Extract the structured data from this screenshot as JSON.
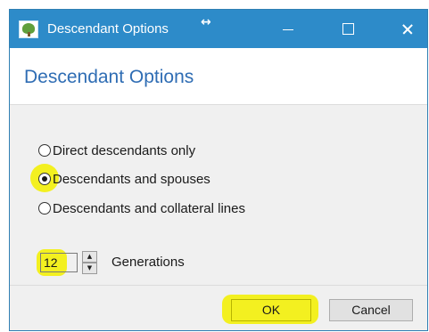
{
  "window": {
    "title": "Descendant Options"
  },
  "header": {
    "title": "Descendant Options"
  },
  "options": {
    "items": [
      {
        "label": "Direct descendants only",
        "checked": false
      },
      {
        "label": "Descendants and spouses",
        "checked": true
      },
      {
        "label": "Descendants and collateral lines",
        "checked": false
      }
    ]
  },
  "generations": {
    "value": "12",
    "label": "Generations"
  },
  "buttons": {
    "ok": "OK",
    "cancel": "Cancel"
  },
  "colors": {
    "titlebar": "#2d8bc9",
    "title_text": "#2f6db4",
    "highlight": "#f3f020"
  },
  "icons": {
    "app": "family-tree-icon",
    "move": "move-arrows-icon"
  }
}
